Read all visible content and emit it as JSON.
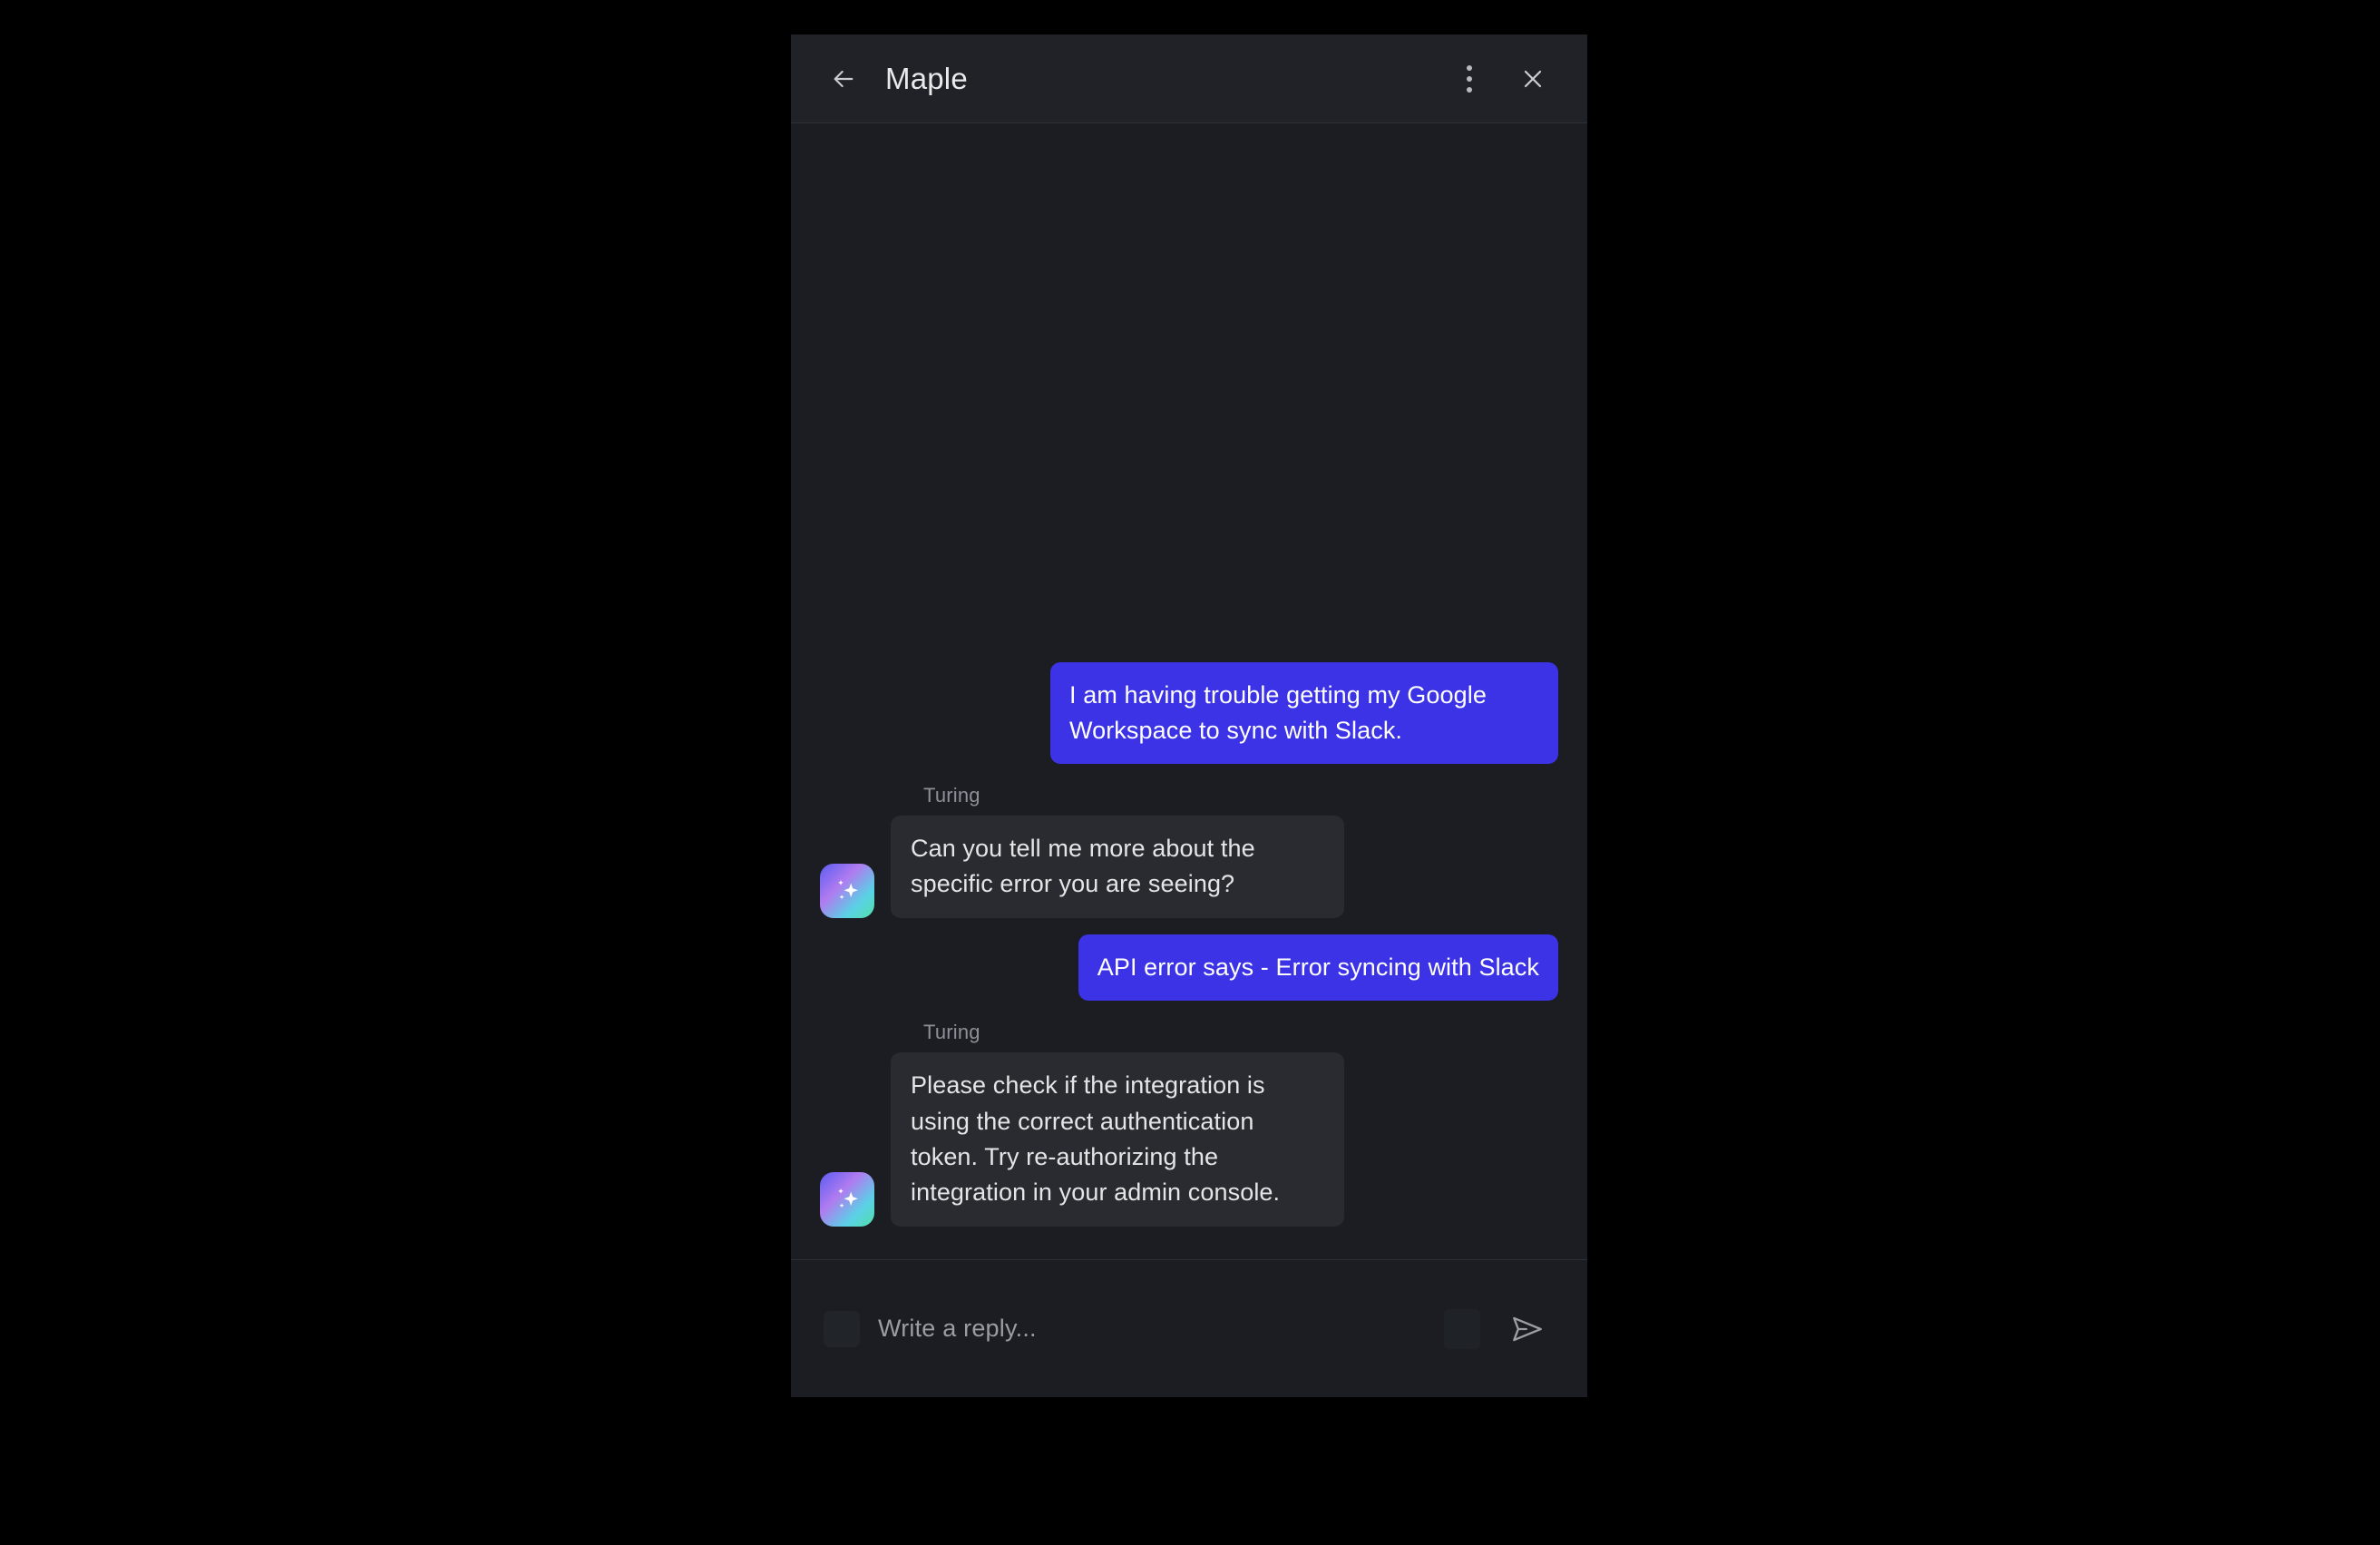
{
  "window": {
    "background_color": "#000000",
    "panel_background": "#1b1d22"
  },
  "header": {
    "title": "Maple",
    "back_icon": "arrow-left-icon",
    "menu_icon": "kebab-menu-icon",
    "close_icon": "close-icon",
    "background_color": "#202227"
  },
  "conversation": {
    "assistant_name": "Turing",
    "avatar_icon": "sparkle-icon",
    "user_bubble_color": "#3b33e5",
    "bot_bubble_color": "#2a2b30",
    "messages": [
      {
        "role": "user",
        "text": "I am having trouble getting my Google Workspace to sync with Slack."
      },
      {
        "role": "assistant",
        "sender": "Turing",
        "text": "Can you tell me more about the specific error you are seeing?"
      },
      {
        "role": "user",
        "text": "API error says - Error syncing with Slack"
      },
      {
        "role": "assistant",
        "sender": "Turing",
        "text": "Please check if the integration is using the correct authentication token. Try re-authorizing the integration in your admin console."
      }
    ]
  },
  "composer": {
    "placeholder": "Write a reply...",
    "value": "",
    "send_icon": "send-icon",
    "attachment_icon": "attachment-placeholder-icon",
    "emoji_icon": "emoji-placeholder-icon"
  }
}
